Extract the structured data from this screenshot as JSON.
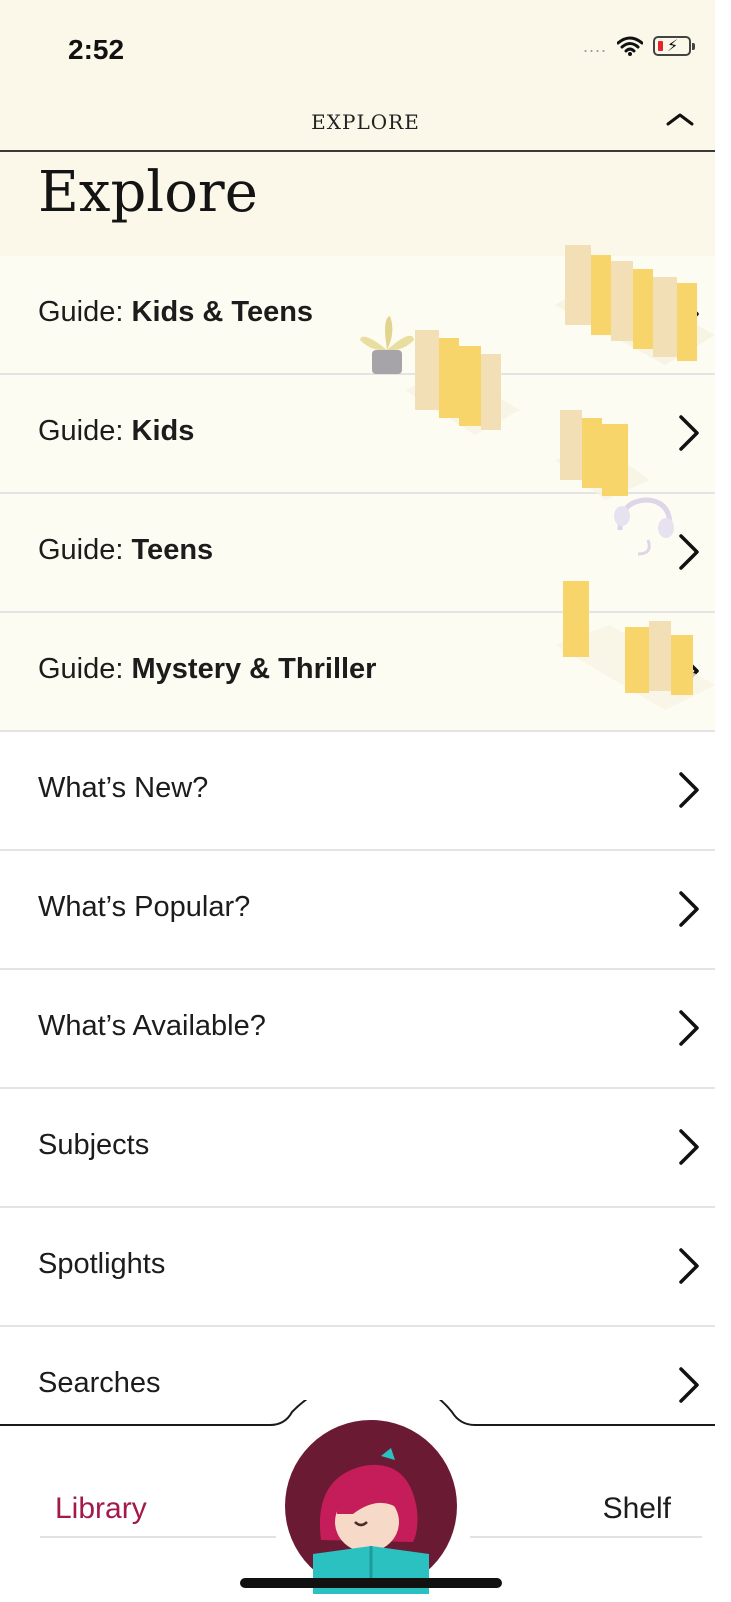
{
  "status_bar": {
    "time": "2:52",
    "signal": "....",
    "battery_color": "#e4262c"
  },
  "nav": {
    "title": "EXPLORE",
    "collapse_icon": "chevron-up-icon"
  },
  "header": {
    "title": "Explore"
  },
  "rows": [
    {
      "lead": "Guide: ",
      "bold": "Kids & Teens",
      "type": "guide"
    },
    {
      "lead": "Guide: ",
      "bold": "Kids",
      "type": "guide"
    },
    {
      "lead": "Guide: ",
      "bold": "Teens",
      "type": "guide"
    },
    {
      "lead": "Guide: ",
      "bold": "Mystery & Thriller",
      "type": "guide"
    },
    {
      "lead": "What’s New?",
      "bold": "",
      "type": "plain"
    },
    {
      "lead": "What’s Popular?",
      "bold": "",
      "type": "plain"
    },
    {
      "lead": "What’s Available?",
      "bold": "",
      "type": "plain"
    },
    {
      "lead": "Subjects",
      "bold": "",
      "type": "plain"
    },
    {
      "lead": "Spotlights",
      "bold": "",
      "type": "plain"
    },
    {
      "lead": "Searches",
      "bold": "",
      "type": "plain"
    }
  ],
  "tabs": {
    "library": "Library",
    "shelf": "Shelf",
    "center_icon": "libby-logo-icon"
  },
  "colors": {
    "accent": "#a2194a",
    "header_bg": "#fbf8ea",
    "logo_bg": "#6b1a34",
    "book_yellow": "#f7d56b"
  }
}
